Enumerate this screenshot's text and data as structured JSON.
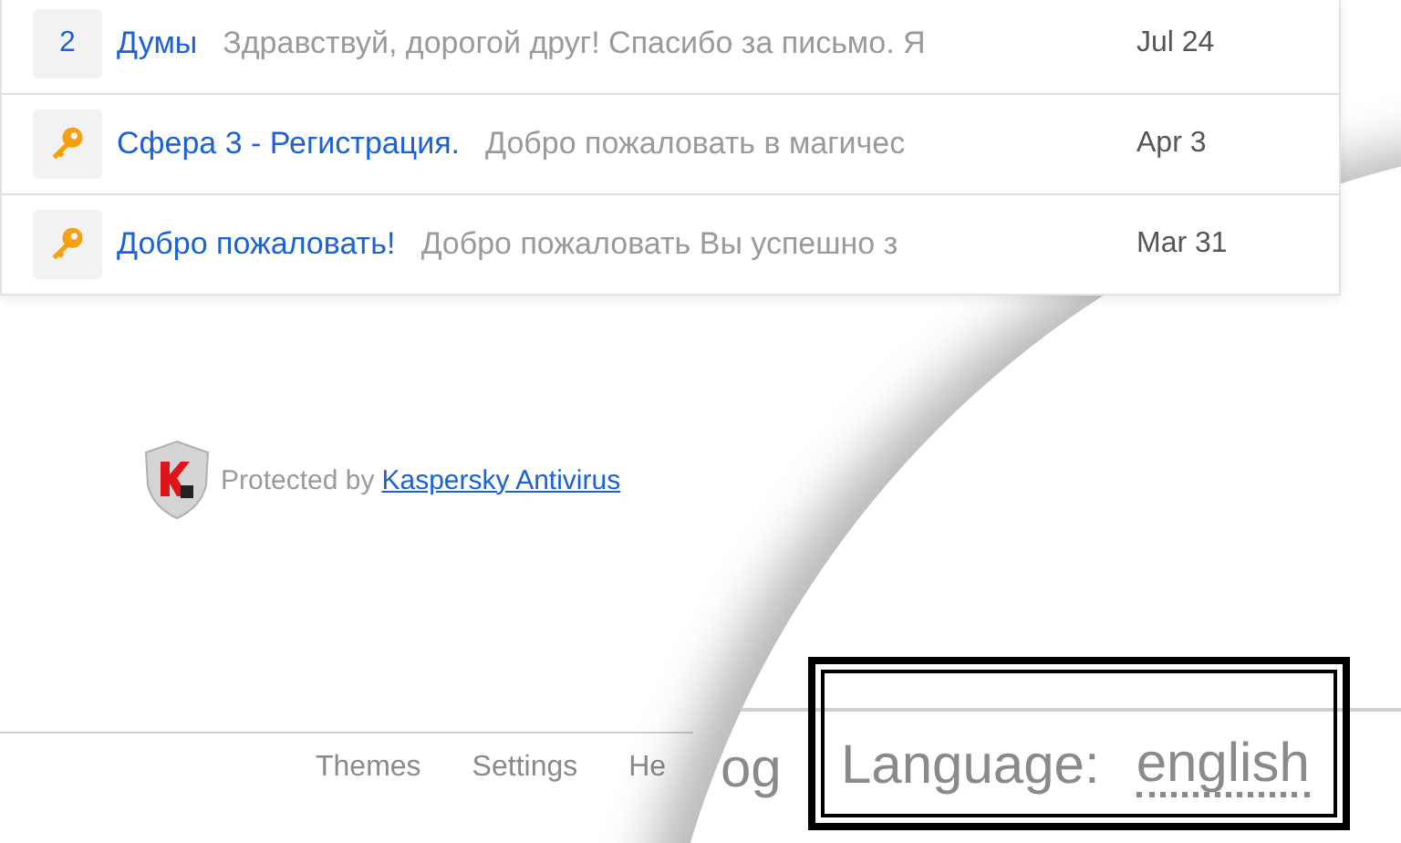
{
  "messages": [
    {
      "kind": "count",
      "badge": "2",
      "sender": "Думы",
      "snippet": "Здравствуй, дорогой друг! Спасибо за письмо. Я",
      "date": "Jul 24"
    },
    {
      "kind": "key",
      "sender": "Сфера 3 - Регистрация.",
      "snippet": "Добро пожаловать в магичес",
      "date": "Apr 3"
    },
    {
      "kind": "key",
      "sender": "Добро пожаловать!",
      "snippet": "Добро пожаловать Вы успешно з",
      "date": "Mar 31"
    }
  ],
  "protection": {
    "text": "Protected by",
    "link": "Kaspersky Antivirus"
  },
  "footer_links": [
    "Themes",
    "Settings",
    "He"
  ],
  "magnifier": {
    "fragment": "og",
    "label": "Language:",
    "value": "english"
  }
}
